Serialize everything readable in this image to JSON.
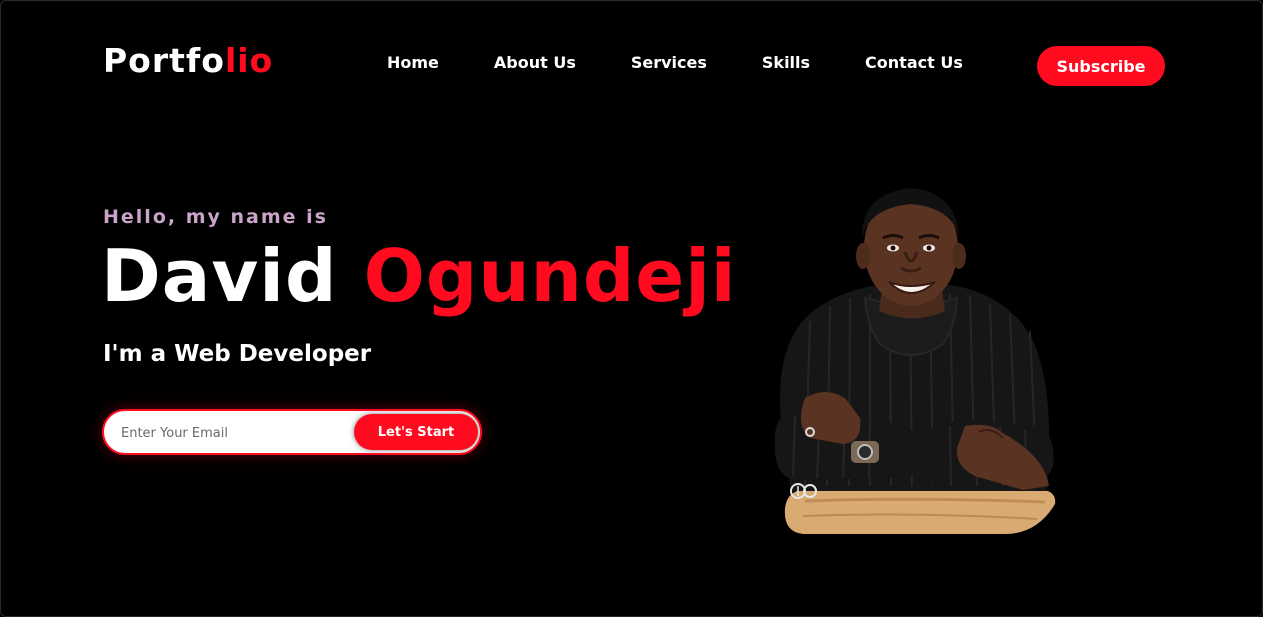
{
  "header": {
    "logo_main": "Portfo",
    "logo_accent": "lio",
    "nav": [
      "Home",
      "About Us",
      "Services",
      "Skills",
      "Contact Us"
    ],
    "subscribe_label": "Subscribe"
  },
  "hero": {
    "greeting": "Hello, my name is",
    "first_name": "David",
    "last_name": "Ogundeji",
    "role": "I'm a Web Developer",
    "email_placeholder": "Enter Your Email",
    "cta_label": "Let's Start"
  },
  "colors": {
    "background": "#000000",
    "accent": "#ff0a1f",
    "greeting": "#c9a3c9",
    "text": "#ffffff"
  },
  "icons": {
    "watermark": "op-watermark-icon"
  }
}
